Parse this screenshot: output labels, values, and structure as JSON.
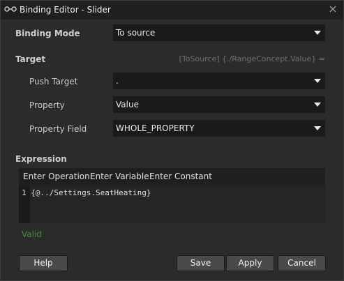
{
  "window": {
    "title": "Binding Editor - Slider"
  },
  "binding_mode": {
    "label": "Binding Mode",
    "value": "To source"
  },
  "target": {
    "label": "Target",
    "hint": "[ToSource] {./RangeConcept.Value} =",
    "push_target": {
      "label": "Push Target",
      "value": "."
    },
    "property": {
      "label": "Property",
      "value": "Value"
    },
    "property_field": {
      "label": "Property Field",
      "value": "WHOLE_PROPERTY"
    }
  },
  "expression": {
    "label": "Expression",
    "toolbar": [
      "Enter Operation",
      "Enter Variable",
      "Enter Constant"
    ],
    "lines": [
      {
        "number": "1",
        "code": "{@../Settings.SeatHeating}"
      }
    ]
  },
  "status": {
    "text": "Valid",
    "color": "#3f8a3f"
  },
  "buttons": {
    "help": "Help",
    "save": "Save",
    "apply": "Apply",
    "cancel": "Cancel"
  },
  "icons": {
    "title": "link-icon",
    "close": "close-icon",
    "dropdown": "chevron-down-icon"
  }
}
